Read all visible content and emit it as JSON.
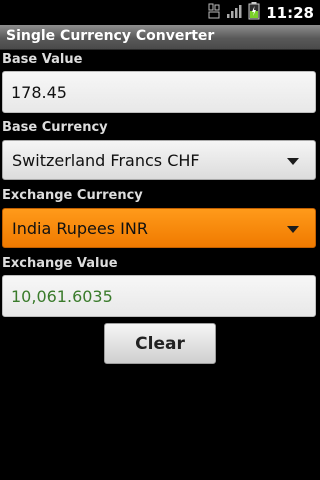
{
  "status_bar": {
    "time": "11:28",
    "icons": [
      "data-sync-icon",
      "signal-strength-icon",
      "battery-charging-icon"
    ]
  },
  "title_bar": {
    "title": "Single Currency Converter"
  },
  "form": {
    "base_value_label": "Base Value",
    "base_value": "178.45",
    "base_currency_label": "Base Currency",
    "base_currency": "Switzerland Francs CHF",
    "exchange_currency_label": "Exchange Currency",
    "exchange_currency": "India Rupees INR",
    "exchange_value_label": "Exchange Value",
    "exchange_value": "10,061.6035",
    "clear_label": "Clear"
  },
  "colors": {
    "selected_spinner": "#f07a00",
    "result_text": "#3a7b2b"
  }
}
